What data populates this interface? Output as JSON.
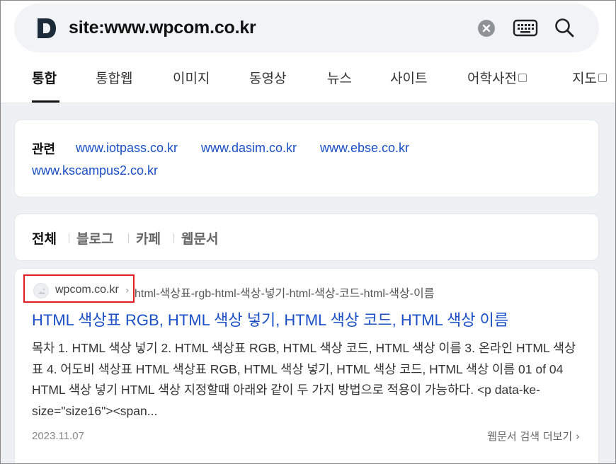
{
  "search": {
    "query": "site:www.wpcom.co.kr"
  },
  "tabs": [
    {
      "label": "통합"
    },
    {
      "label": "통합웹"
    },
    {
      "label": "이미지"
    },
    {
      "label": "동영상"
    },
    {
      "label": "뉴스"
    },
    {
      "label": "사이트"
    },
    {
      "label": "어학사전"
    },
    {
      "label": "지도"
    }
  ],
  "related": {
    "title": "관련",
    "links": [
      "www.iotpass.co.kr",
      "www.dasim.co.kr",
      "www.ebse.co.kr",
      "www.kscampus2.co.kr"
    ]
  },
  "filters": [
    "전체",
    "블로그",
    "카페",
    "웹문서"
  ],
  "result": {
    "site": "wpcom.co.kr",
    "path": "html-색상표-rgb-html-색상-넣기-html-색상-코드-html-색상-이름",
    "title": "HTML 색상표 RGB, HTML 색상 넣기, HTML 색상 코드, HTML 색상 이름",
    "snippet": "목차 1. HTML 색상 넣기 2. HTML 색상표 RGB, HTML 색상 코드, HTML 색상 이름 3. 온라인 HTML 색상표 4. 어도비 색상표 HTML 색상표 RGB, HTML 색상 넣기, HTML 색상 코드, HTML 색상 이름 01 of 04 HTML 색상 넣기 HTML 색상 지정할때 아래와 같이 두 가지 방법으로 적용이 가능하다. <p data-ke-size=\"size16\"><span...",
    "date": "2023.11.07",
    "more": "웹문서 검색 더보기"
  },
  "colors": {
    "link": "#1a4fc7",
    "highlight": "#e02020",
    "background": "#eef1f4"
  }
}
